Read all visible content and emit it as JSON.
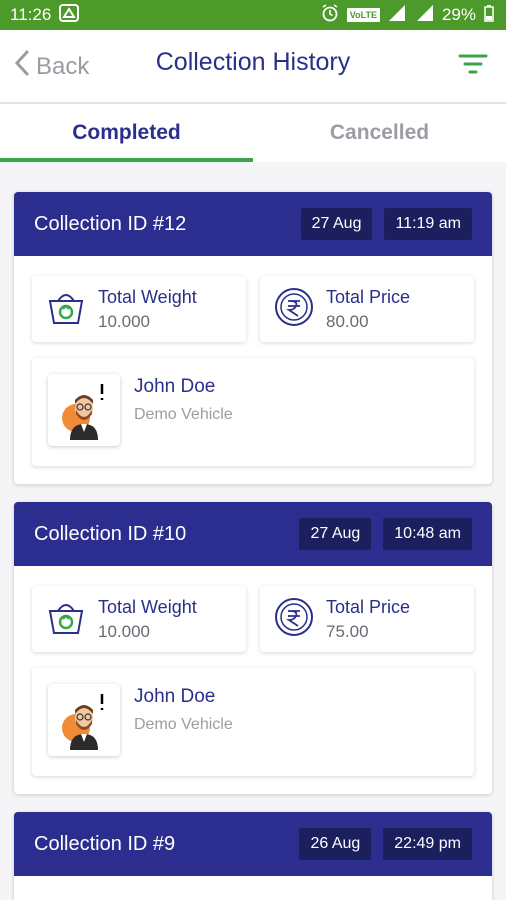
{
  "status": {
    "time": "11:26",
    "network": "VoLTE",
    "battery": "29%"
  },
  "appbar": {
    "back_label": "Back",
    "title": "Collection History"
  },
  "tabs": [
    {
      "label": "Completed"
    },
    {
      "label": "Cancelled"
    }
  ],
  "cards": [
    {
      "collection_id": "Collection ID #12",
      "date": "27 Aug",
      "time": "11:19 am",
      "weight_label": "Total Weight",
      "weight": "10.000",
      "price_label": "Total Price",
      "price": "80.00",
      "name": "John Doe",
      "vehicle": "Demo Vehicle"
    },
    {
      "collection_id": "Collection ID #10",
      "date": "27 Aug",
      "time": "10:48 am",
      "weight_label": "Total Weight",
      "weight": "10.000",
      "price_label": "Total Price",
      "price": "75.00",
      "name": "John Doe",
      "vehicle": "Demo Vehicle"
    },
    {
      "collection_id": "Collection ID #9",
      "date": "26 Aug",
      "time": "22:49 pm"
    }
  ],
  "colors": {
    "primary": "#2b2e8f",
    "accent": "#39a64a",
    "status_bar": "#4c9a2a"
  }
}
